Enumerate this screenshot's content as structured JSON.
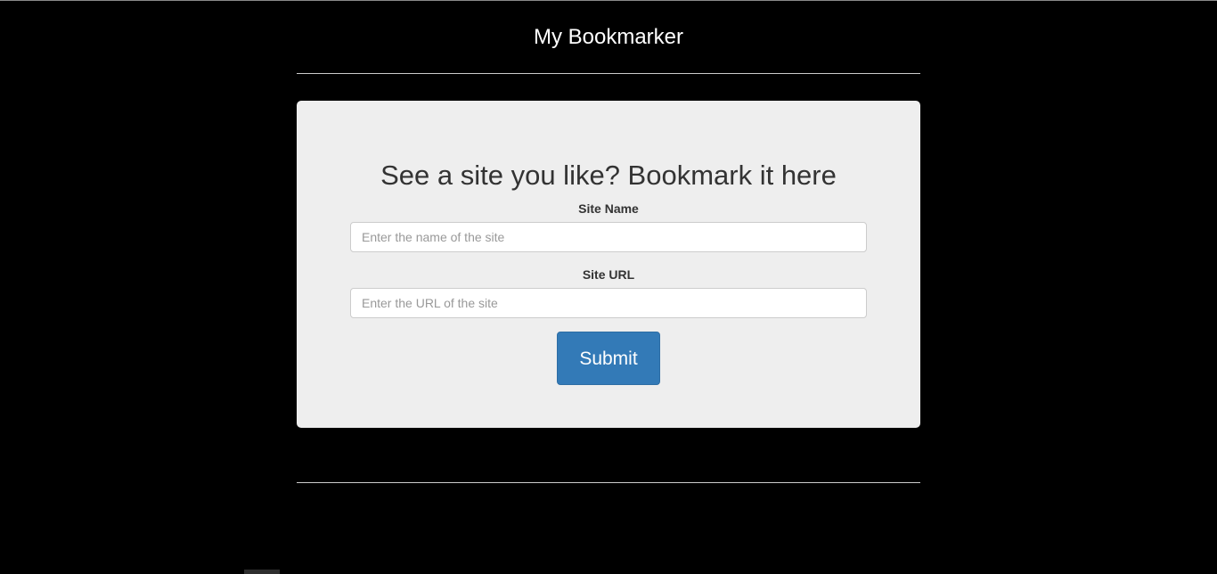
{
  "header": {
    "title": "My Bookmarker"
  },
  "form": {
    "heading": "See a site you like? Bookmark it here",
    "site_name": {
      "label": "Site Name",
      "value": "",
      "placeholder": "Enter the name of the site"
    },
    "site_url": {
      "label": "Site URL",
      "value": "",
      "placeholder": "Enter the URL of the site"
    },
    "submit_label": "Submit"
  },
  "colors": {
    "background": "#000000",
    "panel": "#eeeeee",
    "primary_button": "#337ab7",
    "header_text": "#ffffff"
  }
}
